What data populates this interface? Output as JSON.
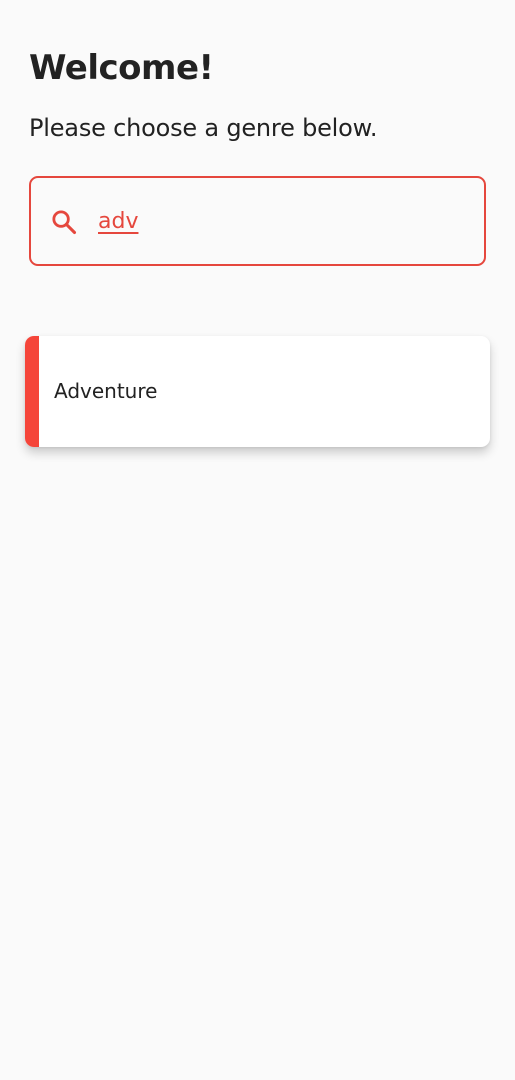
{
  "header": {
    "title": "Welcome!",
    "subtitle": "Please choose a genre below."
  },
  "search": {
    "value": "adv",
    "icon": "search-icon"
  },
  "genres": [
    {
      "label": "Adventure"
    }
  ],
  "colors": {
    "accent": "#f5453a",
    "border": "#e5473d",
    "background": "#fafafa",
    "text": "#222222"
  }
}
